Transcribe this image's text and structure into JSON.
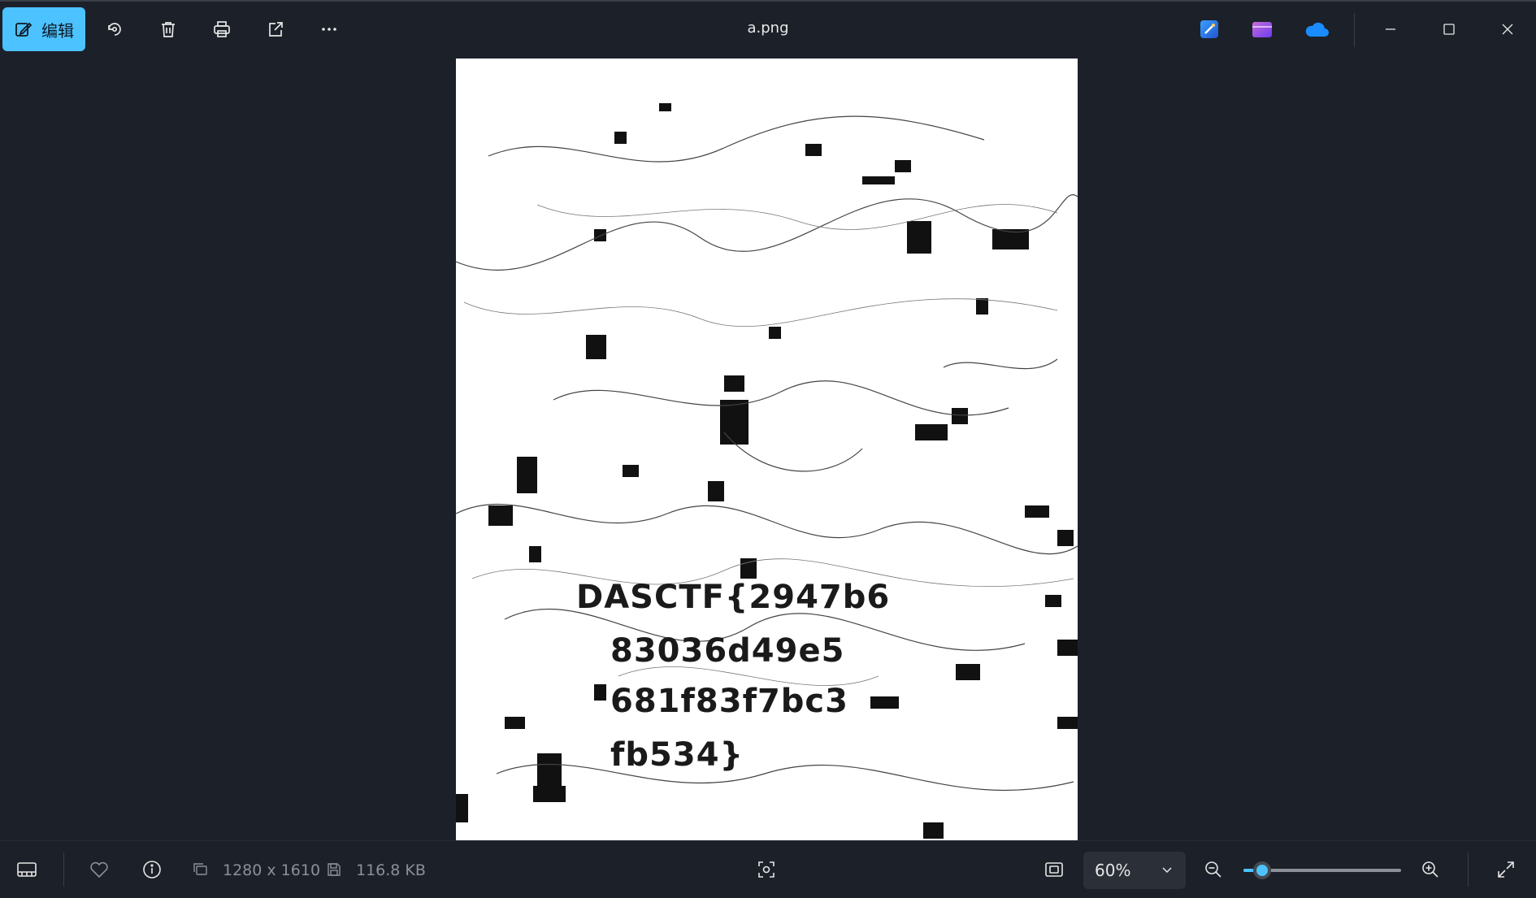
{
  "toolbar": {
    "edit_label": "编辑",
    "title": "a.png",
    "accent": "#4cc2ff"
  },
  "image": {
    "flag_lines": [
      "DASCTF{2947b6",
      "83036d49e5",
      "681f83f7bc3",
      "fb534}"
    ]
  },
  "statusbar": {
    "dimensions": "1280 x 1610",
    "file_size": "116.8 KB",
    "zoom": "60%",
    "zoom_slider_fraction": 0.12
  },
  "icons": [
    "edit-icon",
    "rotate-icon",
    "delete-icon",
    "print-icon",
    "share-icon",
    "more-icon",
    "designer-icon",
    "clipchamp-icon",
    "onedrive-icon",
    "minimize-icon",
    "maximize-icon",
    "close-icon",
    "filmstrip-icon",
    "favorite-icon",
    "info-icon",
    "dimensions-icon",
    "save-icon",
    "visual-search-icon",
    "fit-icon",
    "zoom-out-icon",
    "zoom-in-icon",
    "fullscreen-icon"
  ]
}
